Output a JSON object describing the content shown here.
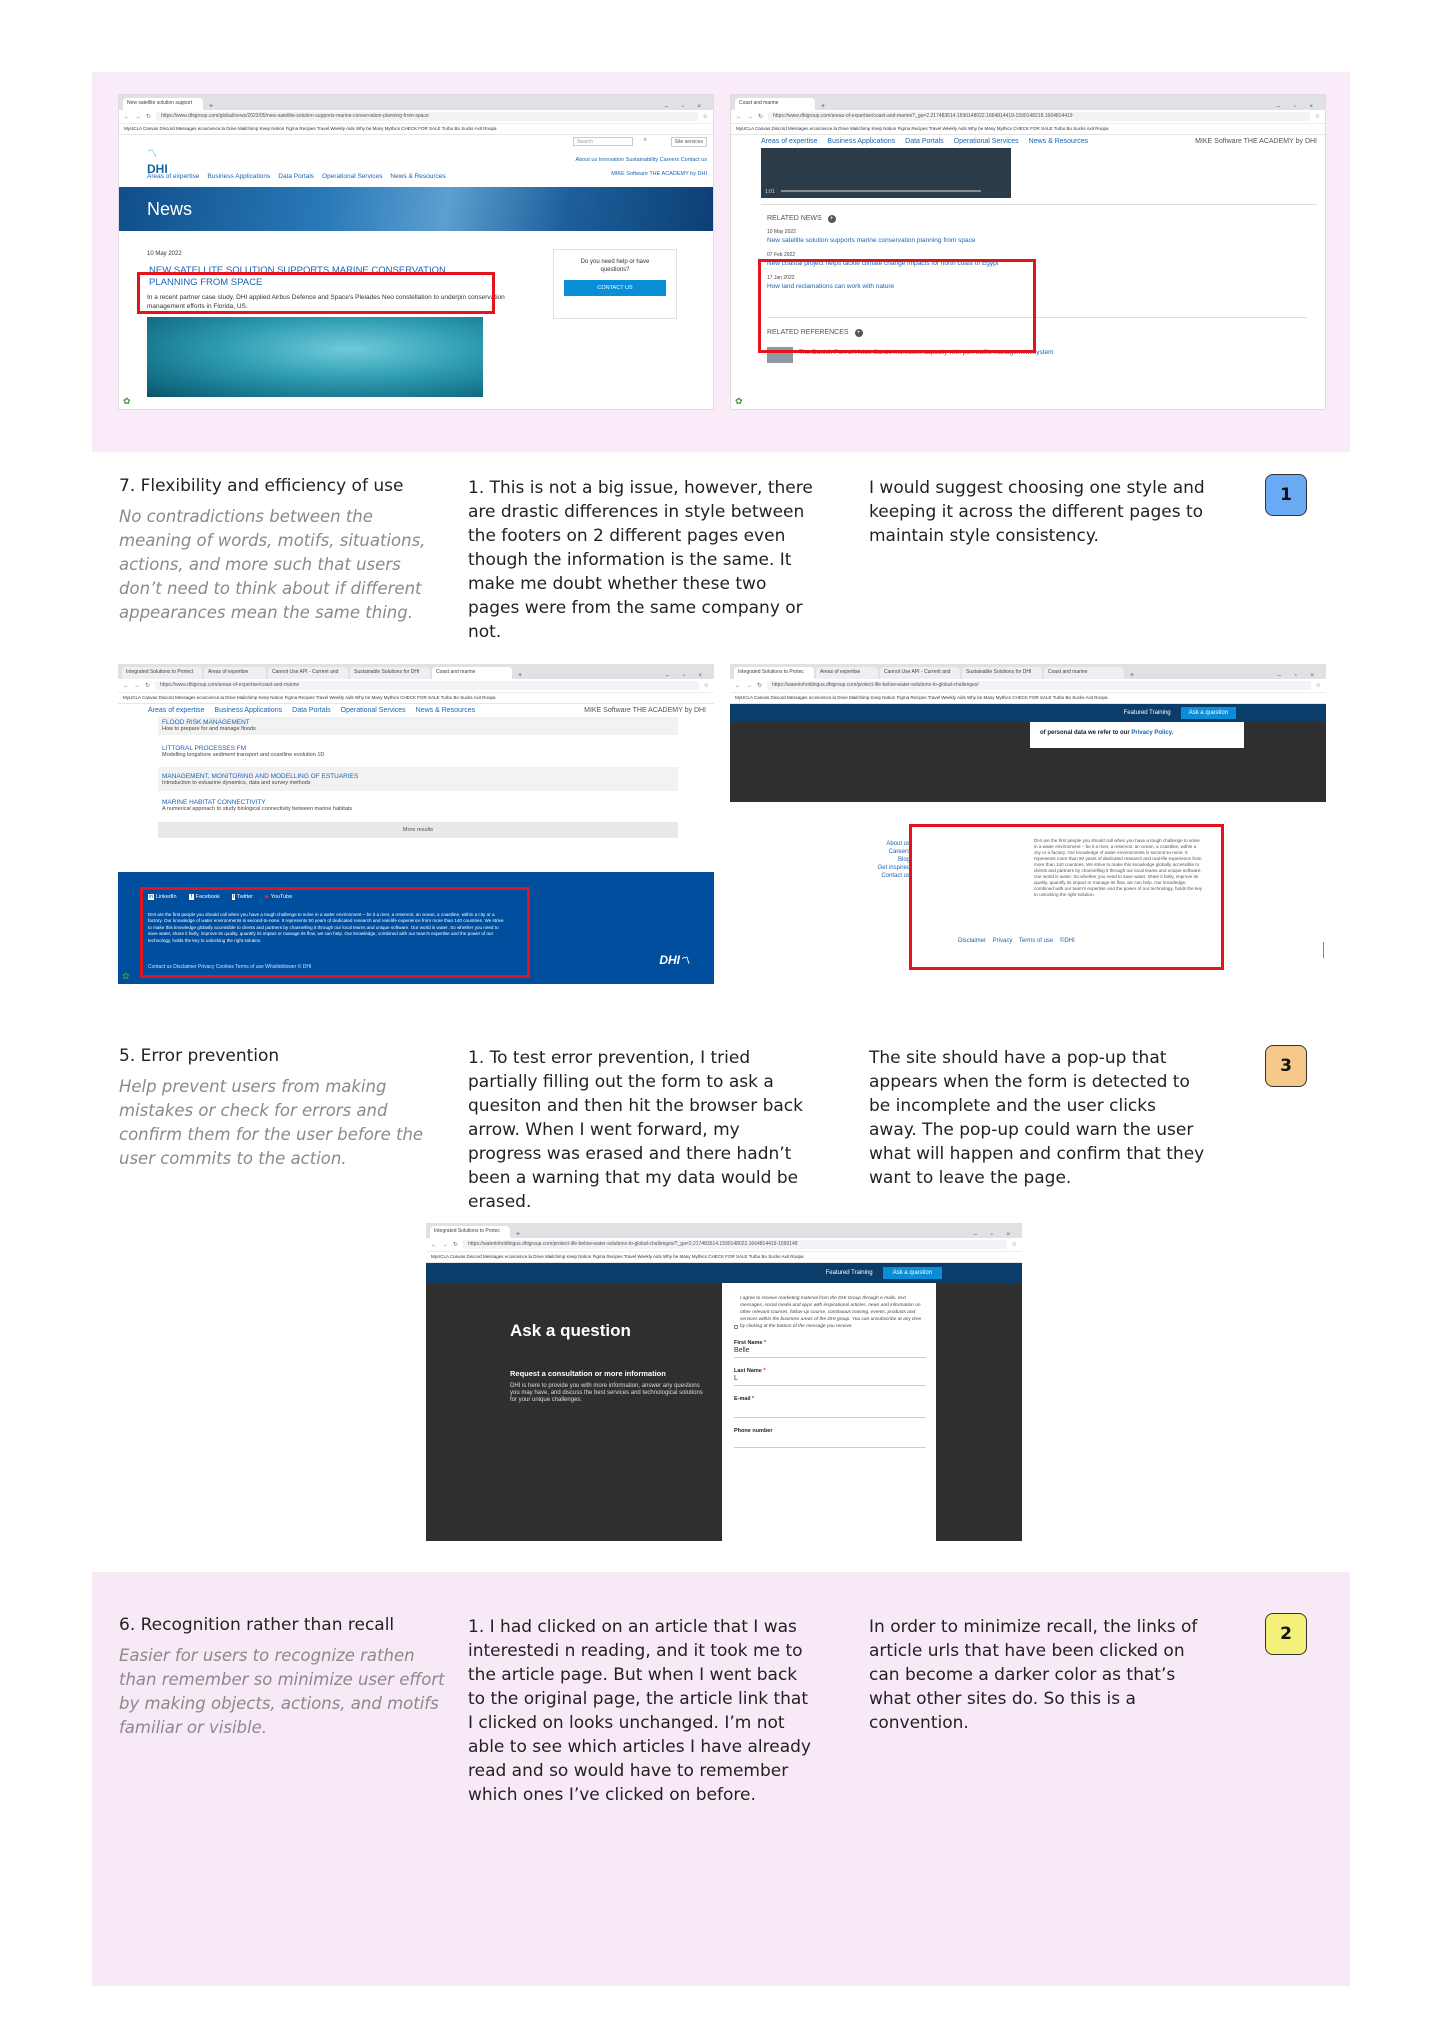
{
  "section1": {
    "shot_left": {
      "tab_title": "New satellite solution support",
      "url": "https://www.dhigroup.com/global/news/2022/05/new-satellite-solution-supports-marine-conservation-planning-from-space",
      "bookmarks": "MyUCLA  Canvas  Discord  Messages  ecoscience.la  Drive  Mailchimp  Keep  Notion  Figma  Recipes  Travel  Weekly Aids  Why be Many Mythics  CHECK FOR SALE  Turbo Bo Sucks Axit  Roopa",
      "search_placeholder": "Search",
      "search_button": "Site services",
      "logo": "DHI",
      "top_links": "About us   Innovation   Sustainability   Careers   Contact us",
      "nav": [
        "Areas of expertise",
        "Business Applications",
        "Data Portals",
        "Operational Services",
        "News & Resources"
      ],
      "nav_right": "MIKE Software    THE ACADEMY by DHI",
      "banner": "News",
      "date": "10 May 2022",
      "headline": "NEW SATELLITE SOLUTION SUPPORTS MARINE CONSERVATION PLANNING FROM SPACE",
      "intro": "In a recent partner case study, DHI applied Airbus Defence and Space's Pleiades Neo constellation to underpin conservation management efforts in Florida, US.",
      "help_text": "Do you need help or have questions?",
      "contact_button": "CONTACT US"
    },
    "shot_right": {
      "tab_title": "Coast and marine",
      "url": "https://www.dhigroup.com/areas-of-expertise/coast-and-marine?_ga=2.217483614.1590148022.1664814419-1590148218.1664814419",
      "video_time": "1:01",
      "related_news_header": "RELATED NEWS",
      "news": [
        {
          "date": "10 May 2022",
          "title": "New satellite solution supports marine conservation planning from space"
        },
        {
          "date": "07 Feb 2022",
          "title": "New coastal project helps tackle climate change impacts for north coast of Egypt"
        },
        {
          "date": "17 Jan 2022",
          "title": "How land reclamations can work with nature"
        }
      ],
      "related_refs_header": "RELATED REFERENCES",
      "ref_title": "The Danish Port of Hvide Sande increases capacity with port traffic management system"
    }
  },
  "issue1": {
    "criterion": "7. Flexibility and efficiency of use",
    "description": "No contradictions between the meaning of words, motifs, situations, actions, and more such that users don’t need to think about if different appearances mean the same thing.",
    "problem": "1. This is not a big issue, however, there are drastic differences in style between the footers on 2 different pages even though the information is the same. It make me doubt whether these two pages were from the same company or not.",
    "suggestion": "I would suggest choosing one style and keeping it across the different pages to maintain style consistency.",
    "severity": "1",
    "severity_color": "#6aa9f4"
  },
  "section2": {
    "shot_left": {
      "tab_titles": [
        "Integrated Solutions to Protect",
        "Areas of expertise",
        "Cannot Use API - Current and",
        "Sustainable Solutions for DHI",
        "Coast and marine"
      ],
      "url": "https://www.dhigroup.com/areas-of-expertise/coast-and-marine",
      "items": [
        {
          "title": "FLOOD RISK MANAGEMENT",
          "desc": "How to prepare for and manage floods"
        },
        {
          "title": "LITTORAL PROCESSES FM",
          "desc": "Modelling longshore sediment transport and coastline evolution 1D"
        },
        {
          "title": "MANAGEMENT, MONITORING AND MODELLING OF ESTUARIES",
          "desc": "Introduction to estuarine dynamics, data and survey methods"
        },
        {
          "title": "MARINE HABITAT CONNECTIVITY",
          "desc": "A numerical approach to study biological connectivity between marine habitats"
        }
      ],
      "more_results": "More results",
      "social": [
        "LinkedIn",
        "Facebook",
        "Twitter",
        "YouTube"
      ],
      "footer_text": "DHI are the first people you should call when you have a tough challenge to solve in a water environment – be it a river, a reservoir, an ocean, a coastline, within a city or a factory. Our knowledge of water environments is second-to-none. It represents 50 years of dedicated research and real-life experience from more than 140 countries. We strive to make this knowledge globally accessible to clients and partners by channelling it through our local teams and unique software. Our world is water. So whether you need to save water, share it fairly, improve its quality, quantify its impact or manage its flow, we can help. Our knowledge, combined with our team's expertise and the power of our technology, holds the key to unlocking the right solution.",
      "footer_links": "Contact us   Disclaimer   Privacy   Cookies   Terms of use   Whistleblower   © DHI",
      "logo": "DHI"
    },
    "shot_right": {
      "tab_titles": [
        "Integrated Solutions to Protec",
        "Areas of expertise",
        "Cannot Use API - Current and",
        "Sustainable Solutions for DHI",
        "Coast and marine"
      ],
      "url": "https://waterinholdingus.dhigroup.com/protect-life-below-water-solutions-to-global-challenges/",
      "featured": "Featured Training",
      "ask_button": "Ask a question",
      "privacy_text": "of personal data we refer to our ",
      "privacy_link": "Privacy Policy.",
      "footer_links": [
        "About us",
        "Careers",
        "Blog",
        "Get inspired",
        "Contact us"
      ],
      "footer_text": "DHI are the first people you should call when you have a tough challenge to solve in a water environment – be it a river, a reservoir, an ocean, a coastline, within a city or a factory. Our knowledge of water environments is second-to-none. It represents more than 50 years of dedicated research and real-life experience from more than 140 countries. We strive to make this knowledge globally accessible to clients and partners by channelling it through our local teams and unique software. Our world is water. So whether you need to save water, share it fairly, improve its quality, quantify its impact or manage its flow, we can help. Our knowledge, combined with our team's expertise and the power of our technology, holds the key to unlocking the right solution.",
      "bottom_links": "Disclaimer    Privacy    Terms of use    ©DHI"
    }
  },
  "issue3": {
    "criterion": "5. Error prevention",
    "description": "Help prevent users from making mistakes or check for errors and confirm them for the user before the user commits to the action.",
    "problem": "1. To test error prevention, I tried partially filling out the form to ask a quesiton and then hit the browser back arrow. When I went forward, my progress was erased and there hadn’t been a warning that my data would be erased.",
    "suggestion": "The site should have a pop-up that appears when the form is detected to be incomplete and the user clicks away. The pop-up could warn the user what will happen and confirm that they want to leave the page.",
    "severity": "3",
    "severity_color": "#f6c88a"
  },
  "form_shot": {
    "tab_title": "Integrated Solutions to Protec",
    "url": "https://waterinholdingus.dhigroup.com/protect-life-below-water-solutions-to-global-challenges/?_ga=2.217483614.1590148022.1664814419-1590148",
    "featured": "Featured Training",
    "ask_button": "Ask a question",
    "heading": "Ask a question",
    "subheading": "Request a consultation or more information",
    "intro": "DHI is here to provide you with more information, answer any questions you may have, and discuss the best services and technological solutions for your unique challenges.",
    "consent": "I agree to receive marketing material from the DHI Group through e-mails, text messages, social media and apps with inspirational articles, news and information on other relevant courses, follow-up course, continuous training, events, products and services within the business areas of the DHI group. You can unsubscribe at any time by clicking at the bottom of the message you receive.",
    "fields": [
      {
        "label": "First Name",
        "required": "*",
        "value": "Belle"
      },
      {
        "label": "Last Name",
        "required": "*",
        "value": "L"
      },
      {
        "label": "E-mail",
        "required": "*",
        "value": ""
      },
      {
        "label": "Phone number",
        "required": "",
        "value": ""
      }
    ]
  },
  "issue2": {
    "criterion": "6. Recognition rather than recall",
    "description": "Easier for users to recognize rathen than remember so minimize user effort by making objects, actions, and motifs familiar or visible.",
    "problem": "1. I had clicked on an article that I was interestedi n reading, and it took me to the article page. But when I went back to the original page, the article link that I clicked on looks unchanged. I’m not able to see which articles I have already read and so would have to remember which ones I’ve clicked on before.",
    "suggestion": "In order to minimize recall, the links of article urls that have been clicked on can become a darker color as that’s what other sites do. So this is a convention.",
    "severity": "2",
    "severity_color": "#f5f07a"
  }
}
